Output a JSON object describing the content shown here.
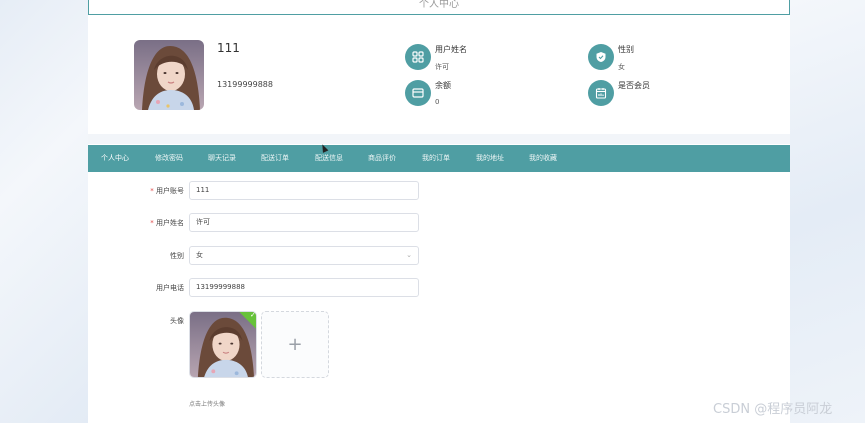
{
  "header": {
    "title": "个人中心"
  },
  "profile": {
    "username": "111",
    "phone": "13199999888",
    "fields": [
      {
        "label": "用户姓名",
        "value": "许可",
        "icon": "grid-icon"
      },
      {
        "label": "性别",
        "value": "女",
        "icon": "shield-icon"
      },
      {
        "label": "余额",
        "value": "0",
        "icon": "wallet-icon"
      },
      {
        "label": "是否会员",
        "value": "",
        "icon": "calendar-icon"
      }
    ]
  },
  "tabs": [
    {
      "label": "个人中心",
      "active": true
    },
    {
      "label": "修改密码"
    },
    {
      "label": "聊天记录"
    },
    {
      "label": "配送订单"
    },
    {
      "label": "配送信息"
    },
    {
      "label": "商品评价"
    },
    {
      "label": "我的订单"
    },
    {
      "label": "我的地址"
    },
    {
      "label": "我的收藏"
    }
  ],
  "form": {
    "account_label": "用户账号",
    "account_value": "111",
    "name_label": "用户姓名",
    "name_value": "许可",
    "gender_label": "性别",
    "gender_value": "女",
    "phone_label": "用户电话",
    "phone_value": "13199999888",
    "avatar_label": "头像",
    "upload_plus": "+",
    "upload_hint": "点击上传头像"
  },
  "watermark": "CSDN @程序员阿龙",
  "colors": {
    "accent": "#4f9ea3",
    "required": "#e04848",
    "success": "#67c23a"
  }
}
